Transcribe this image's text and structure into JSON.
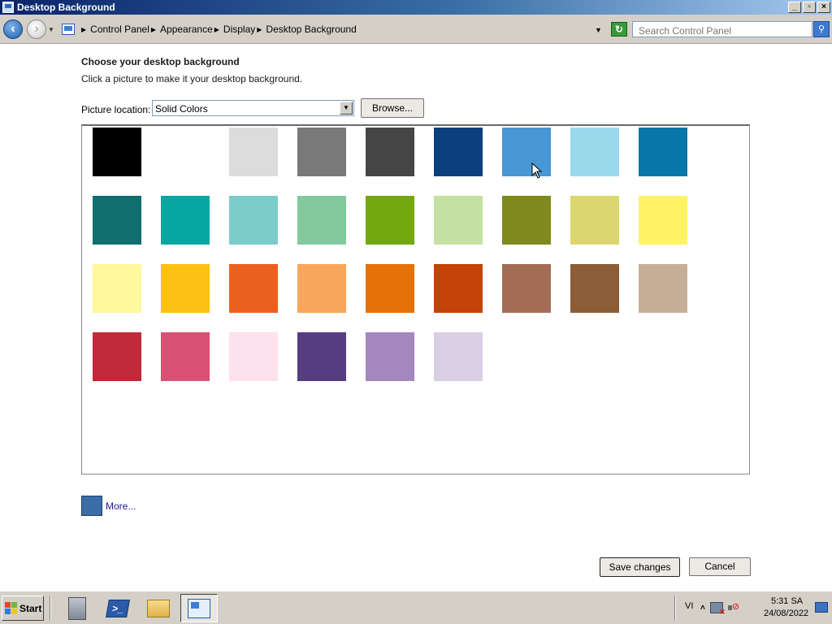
{
  "window": {
    "title": "Desktop Background",
    "minimize": "_",
    "maximize": "▫",
    "close": "×"
  },
  "address": {
    "breadcrumbs": [
      "Control Panel",
      "Appearance",
      "Display",
      "Desktop Background"
    ],
    "search_placeholder": "Search Control Panel"
  },
  "content": {
    "heading": "Choose your desktop background",
    "subheading": "Click a picture to make it your desktop background.",
    "location_label": "Picture location:",
    "location_value": "Solid Colors",
    "browse_label": "Browse..."
  },
  "swatches": [
    [
      "#000000",
      "#ffffff",
      "#dcdcdc",
      "#797979",
      "#454545",
      "#0b3f7e",
      "#4897d4",
      "#9ad8eb",
      "#0776a8"
    ],
    [
      "#106e6e",
      "#06a7a0",
      "#7acdcb",
      "#83c99e",
      "#73a80f",
      "#c5e0a0",
      "#7f8a1d",
      "#dbd66f",
      "#fef465"
    ],
    [
      "#fff89c",
      "#fdc115",
      "#ea611f",
      "#f8a65b",
      "#e57208",
      "#c54208",
      "#a36d55",
      "#8b5e37",
      "#c7ae98"
    ],
    [
      "#bf2b39",
      "#d95274",
      "#fde1ed",
      "#563d80",
      "#a387bd",
      "#d9cfe3"
    ]
  ],
  "selected_swatch": "#4897d4",
  "more": {
    "label": "More...",
    "color": "#3a6ea5"
  },
  "actions": {
    "save": "Save changes",
    "cancel": "Cancel"
  },
  "taskbar": {
    "start": "Start",
    "language": "VI",
    "time": "5:31 SA",
    "date": "24/08/2022"
  }
}
